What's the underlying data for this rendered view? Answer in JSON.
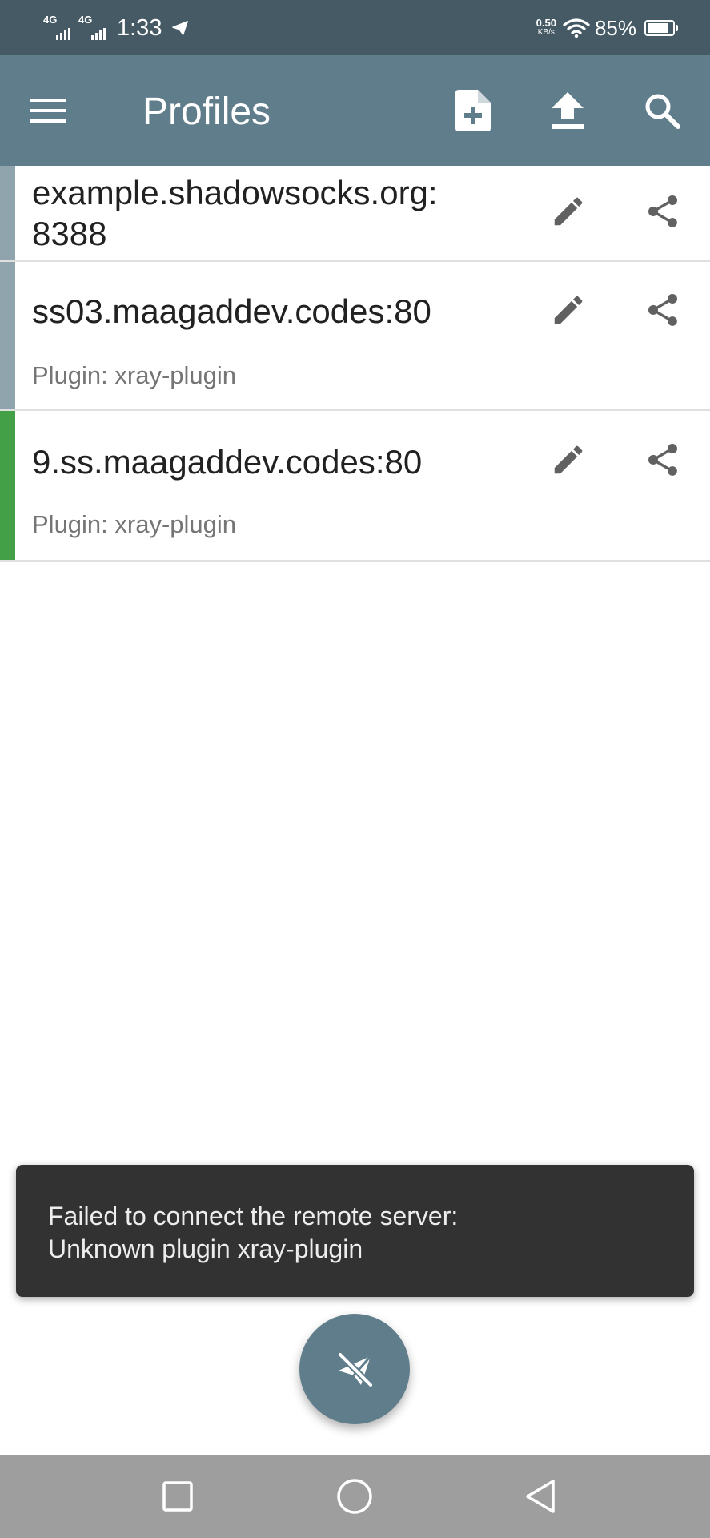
{
  "status_bar": {
    "network_1": "4G",
    "network_2": "4G",
    "time": "1:33",
    "speed_value": "0.50",
    "speed_unit": "KB/s",
    "battery_percent": "85%",
    "battery_level": 0.85
  },
  "app_bar": {
    "title": "Profiles"
  },
  "profiles": [
    {
      "name": "example.shadowsocks.org:\n8388",
      "plugin": "",
      "indicator_color": "#90a4ae",
      "active": false
    },
    {
      "name": "ss03.maagaddev.codes:80",
      "plugin": "Plugin: xray-plugin",
      "indicator_color": "#90a4ae",
      "active": false
    },
    {
      "name": "9.ss.maagaddev.codes:80",
      "plugin": "Plugin: xray-plugin",
      "indicator_color": "#43a047",
      "active": true
    }
  ],
  "snackbar": {
    "message": "Failed to connect the remote server:\nUnknown plugin xray-plugin"
  },
  "colors": {
    "status_bar": "#455a64",
    "app_bar": "#607d8b",
    "fab": "#607d8b",
    "active_indicator": "#43a047",
    "inactive_indicator": "#90a4ae",
    "snackbar": "#323232",
    "nav_bar": "#9e9e9e",
    "icon_gray": "#616161"
  },
  "icons": {
    "menu": "menu-icon",
    "add_profile": "add-document-icon",
    "import": "upload-icon",
    "search": "search-icon",
    "edit": "pencil-icon",
    "share": "share-icon",
    "fab": "paper-plane-off-icon",
    "nav_recents": "square-icon",
    "nav_home": "circle-icon",
    "nav_back": "triangle-back-icon"
  }
}
